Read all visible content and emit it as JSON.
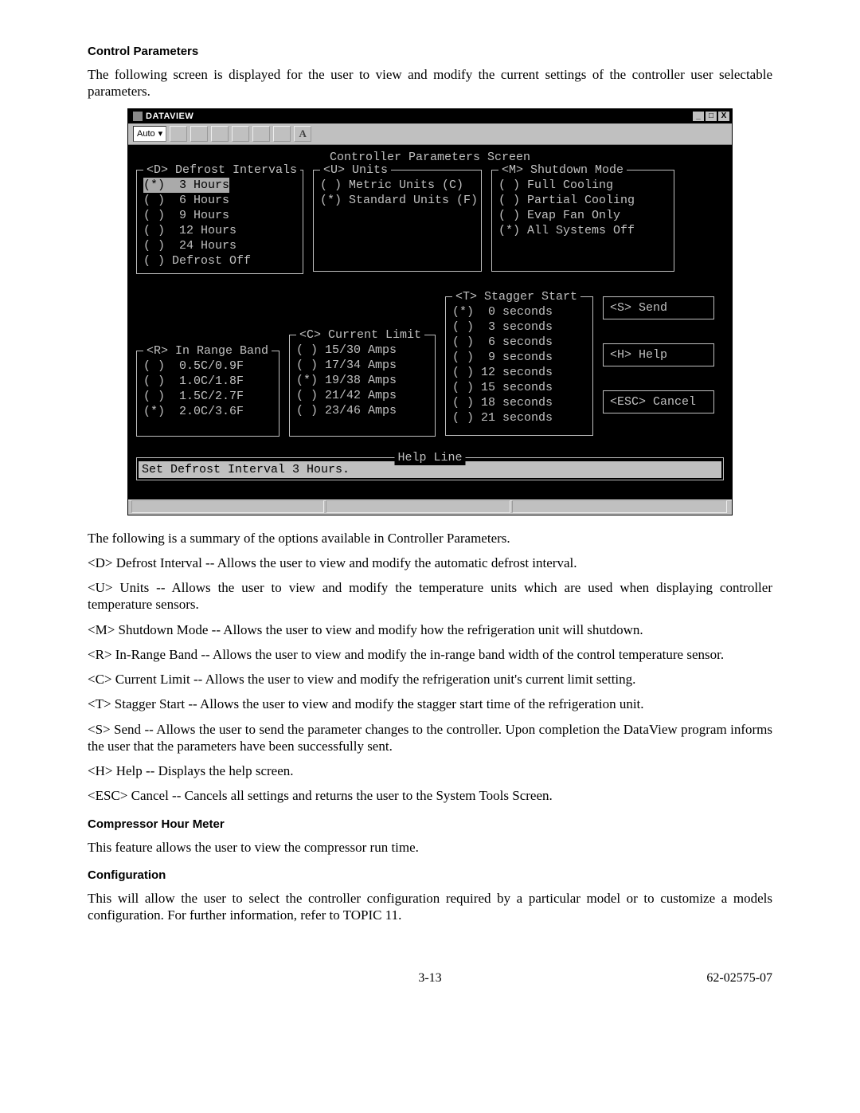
{
  "heading1": "Control Parameters",
  "intro": "The following screen is displayed for the user to view and modify the current settings of the controller user selectable parameters.",
  "window": {
    "title": "DATAVIEW",
    "dropdown": "Auto",
    "minimize": "_",
    "maximize": "□",
    "close": "X"
  },
  "screen_title": "Controller Parameters Screen",
  "groups": {
    "defrost": {
      "legend": "<D> Defrost Intervals",
      "options": [
        {
          "selected": true,
          "label": "3 Hours"
        },
        {
          "selected": false,
          "label": "6 Hours"
        },
        {
          "selected": false,
          "label": "9 Hours"
        },
        {
          "selected": false,
          "label": "12 Hours"
        },
        {
          "selected": false,
          "label": "24 Hours"
        },
        {
          "selected": false,
          "label": "Defrost Off"
        }
      ]
    },
    "units": {
      "legend": "<U> Units",
      "options": [
        {
          "selected": false,
          "label": "Metric Units (C)"
        },
        {
          "selected": true,
          "label": "Standard Units (F)"
        }
      ]
    },
    "shutdown": {
      "legend": "<M> Shutdown Mode",
      "options": [
        {
          "selected": false,
          "label": "Full Cooling"
        },
        {
          "selected": false,
          "label": "Partial Cooling"
        },
        {
          "selected": false,
          "label": "Evap Fan Only"
        },
        {
          "selected": true,
          "label": "All Systems Off"
        }
      ]
    },
    "range": {
      "legend": "<R> In Range Band",
      "options": [
        {
          "selected": false,
          "label": "0.5C/0.9F"
        },
        {
          "selected": false,
          "label": "1.0C/1.8F"
        },
        {
          "selected": false,
          "label": "1.5C/2.7F"
        },
        {
          "selected": true,
          "label": "2.0C/3.6F"
        }
      ]
    },
    "current": {
      "legend": "<C> Current Limit",
      "options": [
        {
          "selected": false,
          "label": "15/30 Amps"
        },
        {
          "selected": false,
          "label": "17/34 Amps"
        },
        {
          "selected": true,
          "label": "19/38 Amps"
        },
        {
          "selected": false,
          "label": "21/42 Amps"
        },
        {
          "selected": false,
          "label": "23/46 Amps"
        }
      ]
    },
    "stagger": {
      "legend": "<T> Stagger Start",
      "options": [
        {
          "selected": true,
          "label": "0 seconds"
        },
        {
          "selected": false,
          "label": "3 seconds"
        },
        {
          "selected": false,
          "label": "6 seconds"
        },
        {
          "selected": false,
          "label": "9 seconds"
        },
        {
          "selected": false,
          "label": "12 seconds"
        },
        {
          "selected": false,
          "label": "15 seconds"
        },
        {
          "selected": false,
          "label": "18 seconds"
        },
        {
          "selected": false,
          "label": "21 seconds"
        }
      ]
    }
  },
  "buttons": {
    "send": "<S> Send",
    "help": "<H> Help",
    "cancel": "<ESC> Cancel"
  },
  "help_legend": "Help Line",
  "help_text": "Set Defrost Interval 3 Hours.",
  "summary_intro": "The following is a summary of the options available in Controller Parameters.",
  "summary": [
    "<D> Defrost Interval -- Allows the user to view and modify the automatic defrost interval.",
    "<U> Units -- Allows the user to view and modify the temperature units which are used when displaying controller temperature sensors.",
    "<M> Shutdown Mode -- Allows the user to view and modify how the refrigeration unit will shutdown.",
    "<R> In-Range Band -- Allows the user to view and modify the in-range band width of the control temperature sensor.",
    "<C> Current Limit -- Allows the user to view and modify the refrigeration unit's current limit setting.",
    "<T> Stagger Start -- Allows the user to view and modify the stagger start time of the refrigeration unit.",
    "<S> Send -- Allows the user to send the parameter changes to the controller. Upon completion the DataView program informs the user that the parameters have been successfully sent.",
    "<H> Help -- Displays the help screen.",
    "<ESC> Cancel -- Cancels all settings and returns the user to the System Tools Screen."
  ],
  "heading2": "Compressor Hour Meter",
  "body2": "This feature allows the user to view the compressor run time.",
  "heading3": "Configuration",
  "body3": "This will allow the user to select the controller configuration required by a particular model or to customize a models configuration. For further information, refer to TOPIC 11.",
  "footer": {
    "page": "3-13",
    "doc": "62-02575-07"
  }
}
